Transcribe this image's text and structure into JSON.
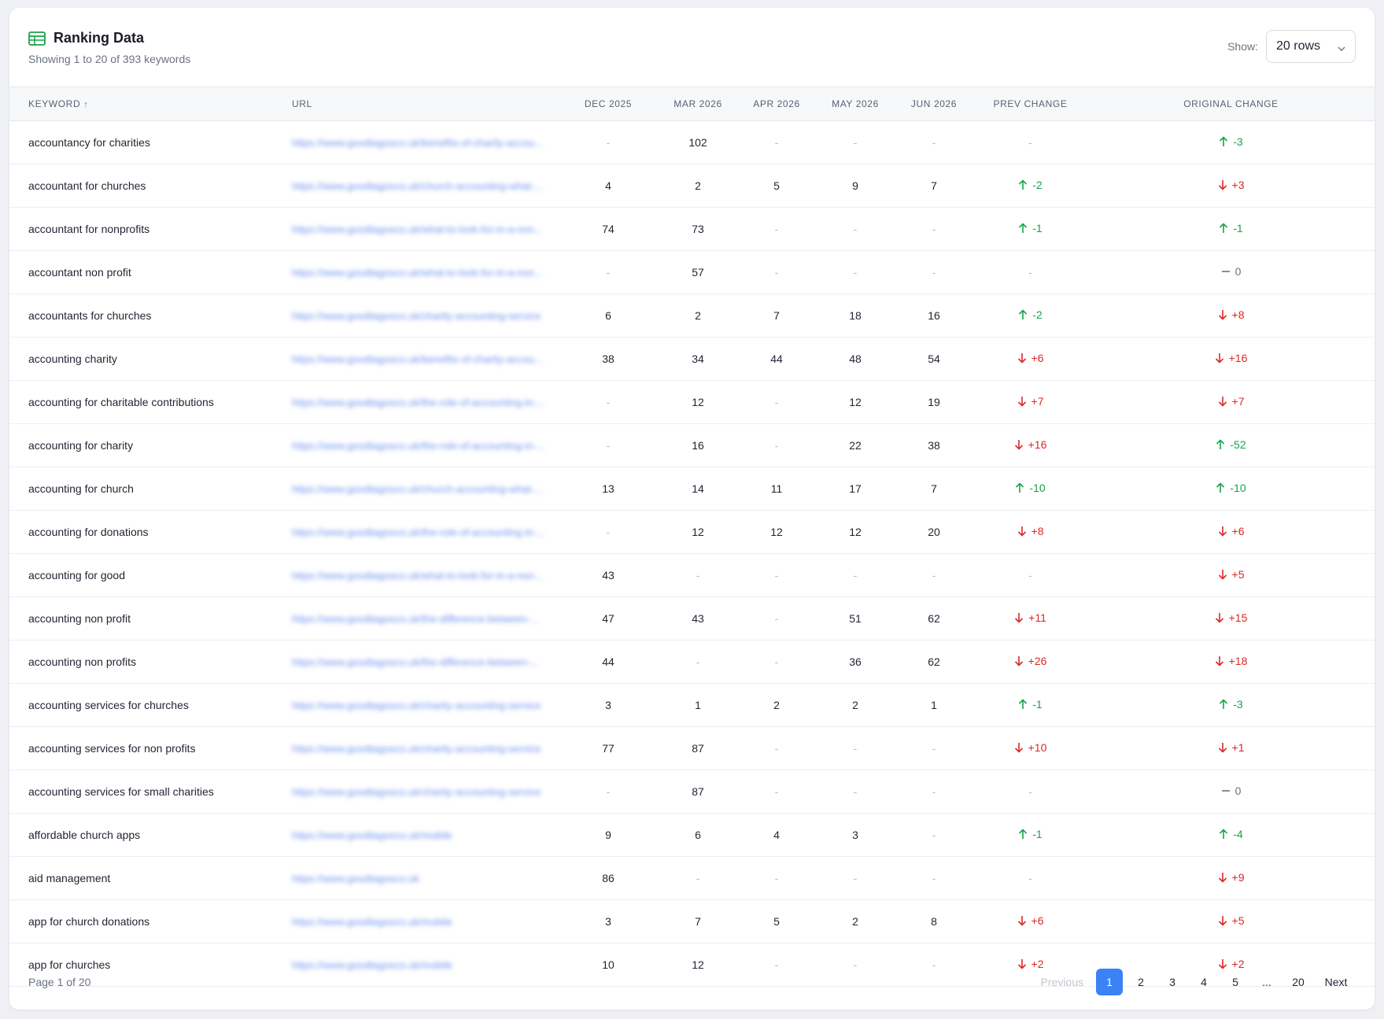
{
  "header": {
    "title": "Ranking Data",
    "subtitle": "Showing 1 to 20 of 393 keywords",
    "show_label": "Show:",
    "rows_value": "20 rows"
  },
  "table": {
    "columns": {
      "keyword": "KEYWORD",
      "url": "URL",
      "m1": "DEC 2025",
      "m2": "MAR 2026",
      "m3": "APR 2026",
      "m4": "MAY 2026",
      "m5": "JUN 2026",
      "prev": "PREV CHANGE",
      "orig": "ORIGINAL CHANGE"
    },
    "rows": [
      {
        "keyword": "accountancy for charities",
        "url": "https://www.goodtagosco.uk/benefits-of-charity-accou...",
        "v": [
          "-",
          "102",
          "-",
          "-",
          "-"
        ],
        "prev": {
          "dir": "none",
          "text": "-"
        },
        "orig": {
          "dir": "up",
          "text": "-3"
        }
      },
      {
        "keyword": "accountant for churches",
        "url": "https://www.goodtagosco.uk/church-accounting-what-...",
        "v": [
          "4",
          "2",
          "5",
          "9",
          "7"
        ],
        "prev": {
          "dir": "up",
          "text": "-2"
        },
        "orig": {
          "dir": "down",
          "text": "+3"
        }
      },
      {
        "keyword": "accountant for nonprofits",
        "url": "https://www.goodtagosco.uk/what-to-look-for-in-a-non...",
        "v": [
          "74",
          "73",
          "-",
          "-",
          "-"
        ],
        "prev": {
          "dir": "up",
          "text": "-1"
        },
        "orig": {
          "dir": "up",
          "text": "-1"
        }
      },
      {
        "keyword": "accountant non profit",
        "url": "https://www.goodtagosco.uk/what-to-look-for-in-a-non...",
        "v": [
          "-",
          "57",
          "-",
          "-",
          "-"
        ],
        "prev": {
          "dir": "none",
          "text": "-"
        },
        "orig": {
          "dir": "flat",
          "text": "0"
        }
      },
      {
        "keyword": "accountants for churches",
        "url": "https://www.goodtagosco.uk/charity-accounting-service",
        "v": [
          "6",
          "2",
          "7",
          "18",
          "16"
        ],
        "prev": {
          "dir": "up",
          "text": "-2"
        },
        "orig": {
          "dir": "down",
          "text": "+8"
        }
      },
      {
        "keyword": "accounting charity",
        "url": "https://www.goodtagosco.uk/benefits-of-charity-accou...",
        "v": [
          "38",
          "34",
          "44",
          "48",
          "54"
        ],
        "prev": {
          "dir": "down",
          "text": "+6"
        },
        "orig": {
          "dir": "down",
          "text": "+16"
        }
      },
      {
        "keyword": "accounting for charitable contributions",
        "url": "https://www.goodtagosco.uk/the-role-of-accounting-in-...",
        "v": [
          "-",
          "12",
          "-",
          "12",
          "19"
        ],
        "prev": {
          "dir": "down",
          "text": "+7"
        },
        "orig": {
          "dir": "down",
          "text": "+7"
        }
      },
      {
        "keyword": "accounting for charity",
        "url": "https://www.goodtagosco.uk/the-role-of-accounting-in-...",
        "v": [
          "-",
          "16",
          "-",
          "22",
          "38"
        ],
        "prev": {
          "dir": "down",
          "text": "+16"
        },
        "orig": {
          "dir": "up",
          "text": "-52"
        }
      },
      {
        "keyword": "accounting for church",
        "url": "https://www.goodtagosco.uk/church-accounting-what-...",
        "v": [
          "13",
          "14",
          "11",
          "17",
          "7"
        ],
        "prev": {
          "dir": "up",
          "text": "-10"
        },
        "orig": {
          "dir": "up",
          "text": "-10"
        }
      },
      {
        "keyword": "accounting for donations",
        "url": "https://www.goodtagosco.uk/the-role-of-accounting-in-...",
        "v": [
          "-",
          "12",
          "12",
          "12",
          "20"
        ],
        "prev": {
          "dir": "down",
          "text": "+8"
        },
        "orig": {
          "dir": "down",
          "text": "+6"
        }
      },
      {
        "keyword": "accounting for good",
        "url": "https://www.goodtagosco.uk/what-to-look-for-in-a-non...",
        "v": [
          "43",
          "-",
          "-",
          "-",
          "-"
        ],
        "prev": {
          "dir": "none",
          "text": "-"
        },
        "orig": {
          "dir": "down",
          "text": "+5"
        }
      },
      {
        "keyword": "accounting non profit",
        "url": "https://www.goodtagosco.uk/the-difference-between-...",
        "v": [
          "47",
          "43",
          "-",
          "51",
          "62"
        ],
        "prev": {
          "dir": "down",
          "text": "+11"
        },
        "orig": {
          "dir": "down",
          "text": "+15"
        }
      },
      {
        "keyword": "accounting non profits",
        "url": "https://www.goodtagosco.uk/the-difference-between-...",
        "v": [
          "44",
          "-",
          "-",
          "36",
          "62"
        ],
        "prev": {
          "dir": "down",
          "text": "+26"
        },
        "orig": {
          "dir": "down",
          "text": "+18"
        }
      },
      {
        "keyword": "accounting services for churches",
        "url": "https://www.goodtagosco.uk/charity-accounting-service",
        "v": [
          "3",
          "1",
          "2",
          "2",
          "1"
        ],
        "prev": {
          "dir": "up",
          "text": "-1"
        },
        "orig": {
          "dir": "up",
          "text": "-3"
        }
      },
      {
        "keyword": "accounting services for non profits",
        "url": "https://www.goodtagosco.uk/charity-accounting-service",
        "v": [
          "77",
          "87",
          "-",
          "-",
          "-"
        ],
        "prev": {
          "dir": "down",
          "text": "+10"
        },
        "orig": {
          "dir": "down",
          "text": "+1"
        }
      },
      {
        "keyword": "accounting services for small charities",
        "url": "https://www.goodtagosco.uk/charity-accounting-service",
        "v": [
          "-",
          "87",
          "-",
          "-",
          "-"
        ],
        "prev": {
          "dir": "none",
          "text": "-"
        },
        "orig": {
          "dir": "flat",
          "text": "0"
        }
      },
      {
        "keyword": "affordable church apps",
        "url": "https://www.goodtagosco.uk/mobile",
        "v": [
          "9",
          "6",
          "4",
          "3",
          "-"
        ],
        "prev": {
          "dir": "up",
          "text": "-1"
        },
        "orig": {
          "dir": "up",
          "text": "-4"
        }
      },
      {
        "keyword": "aid management",
        "url": "https://www.goodtagosco.uk",
        "v": [
          "86",
          "-",
          "-",
          "-",
          "-"
        ],
        "prev": {
          "dir": "none",
          "text": "-"
        },
        "orig": {
          "dir": "down",
          "text": "+9"
        }
      },
      {
        "keyword": "app for church donations",
        "url": "https://www.goodtagosco.uk/mobile",
        "v": [
          "3",
          "7",
          "5",
          "2",
          "8"
        ],
        "prev": {
          "dir": "down",
          "text": "+6"
        },
        "orig": {
          "dir": "down",
          "text": "+5"
        }
      },
      {
        "keyword": "app for churches",
        "url": "https://www.goodtagosco.uk/mobile",
        "v": [
          "10",
          "12",
          "-",
          "-",
          "-"
        ],
        "prev": {
          "dir": "down",
          "text": "+2"
        },
        "orig": {
          "dir": "down",
          "text": "+2"
        }
      }
    ]
  },
  "footer": {
    "page_info": "Page 1 of 20",
    "previous": "Previous",
    "pages": [
      "1",
      "2",
      "3",
      "4",
      "5"
    ],
    "ellipsis": "...",
    "last": "20",
    "next": "Next"
  },
  "colors": {
    "up": "#16a34a",
    "down": "#dc2626",
    "accent": "#3b82f6",
    "icon": "#16a34a"
  }
}
